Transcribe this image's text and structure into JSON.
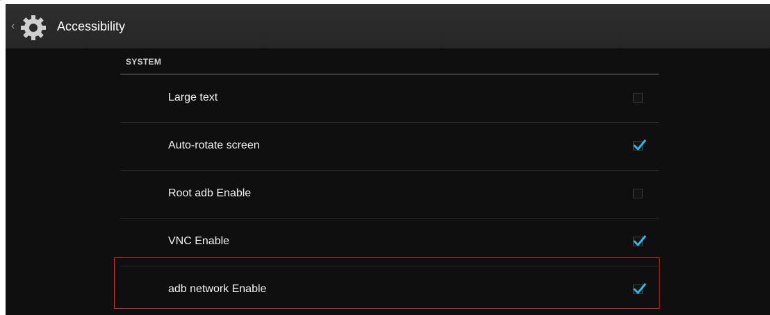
{
  "action_bar": {
    "title": "Accessibility",
    "app_icon": "settings-gear-icon",
    "up_icon": "chevron-left-icon"
  },
  "section": {
    "header": "SYSTEM"
  },
  "settings": [
    {
      "label": "Large text",
      "checked": false
    },
    {
      "label": "Auto-rotate screen",
      "checked": true
    },
    {
      "label": "Root adb Enable",
      "checked": false
    },
    {
      "label": "VNC Enable",
      "checked": true
    },
    {
      "label": "adb network Enable",
      "checked": true
    }
  ],
  "colors": {
    "background": "#0f0f0f",
    "action_bar": "#2a2a2a",
    "check_accent": "#33b5e5",
    "highlight_border": "#d22b2b"
  }
}
